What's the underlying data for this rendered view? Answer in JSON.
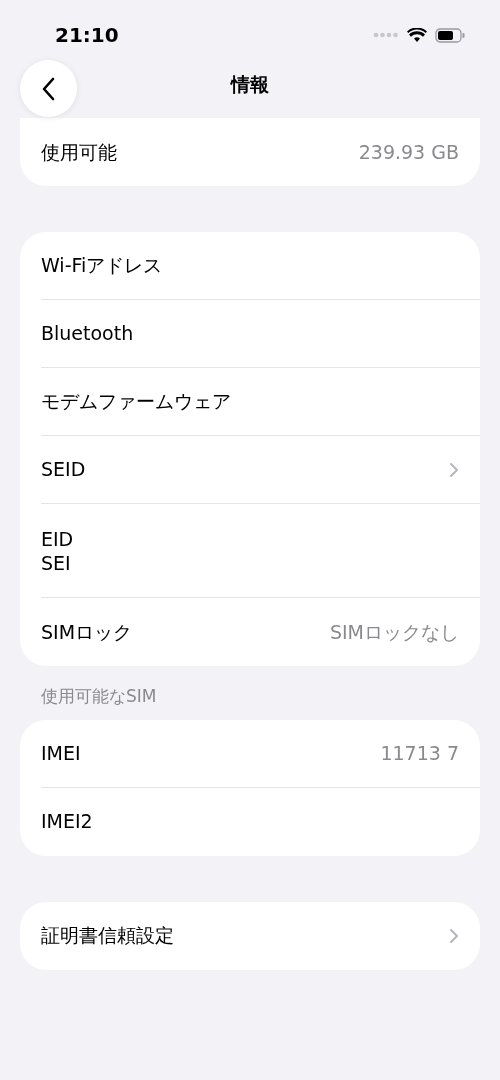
{
  "status_bar": {
    "time": "21:10"
  },
  "nav": {
    "title": "情報"
  },
  "top_card": {
    "rows": [
      {
        "kind": "plain",
        "label": "使用可能",
        "value": "239.93 GB",
        "chevron": false
      }
    ]
  },
  "sections": [
    {
      "rows": [
        {
          "kind": "plain",
          "label": "Wi-Fiアドレス",
          "chevron": false
        },
        {
          "kind": "plain",
          "label": "Bluetooth",
          "chevron": false
        },
        {
          "kind": "plain",
          "label": "モデムファームウェア",
          "chevron": false
        },
        {
          "kind": "plain",
          "label": "SEID",
          "chevron": true
        },
        {
          "kind": "stacked",
          "label": "EID",
          "value": "SEI",
          "chevron": false
        },
        {
          "kind": "plain",
          "label": "SIMロック",
          "value": "SIMロックなし",
          "chevron": false
        }
      ]
    },
    {
      "header": "使用可能なSIM",
      "rows": [
        {
          "kind": "plain",
          "label": "IMEI",
          "value": "11713 7",
          "chevron": false
        },
        {
          "kind": "plain",
          "label": "IMEI2",
          "chevron": false
        }
      ]
    },
    {
      "rows": [
        {
          "kind": "plain",
          "label": "証明書信頼設定",
          "chevron": true
        }
      ]
    }
  ]
}
